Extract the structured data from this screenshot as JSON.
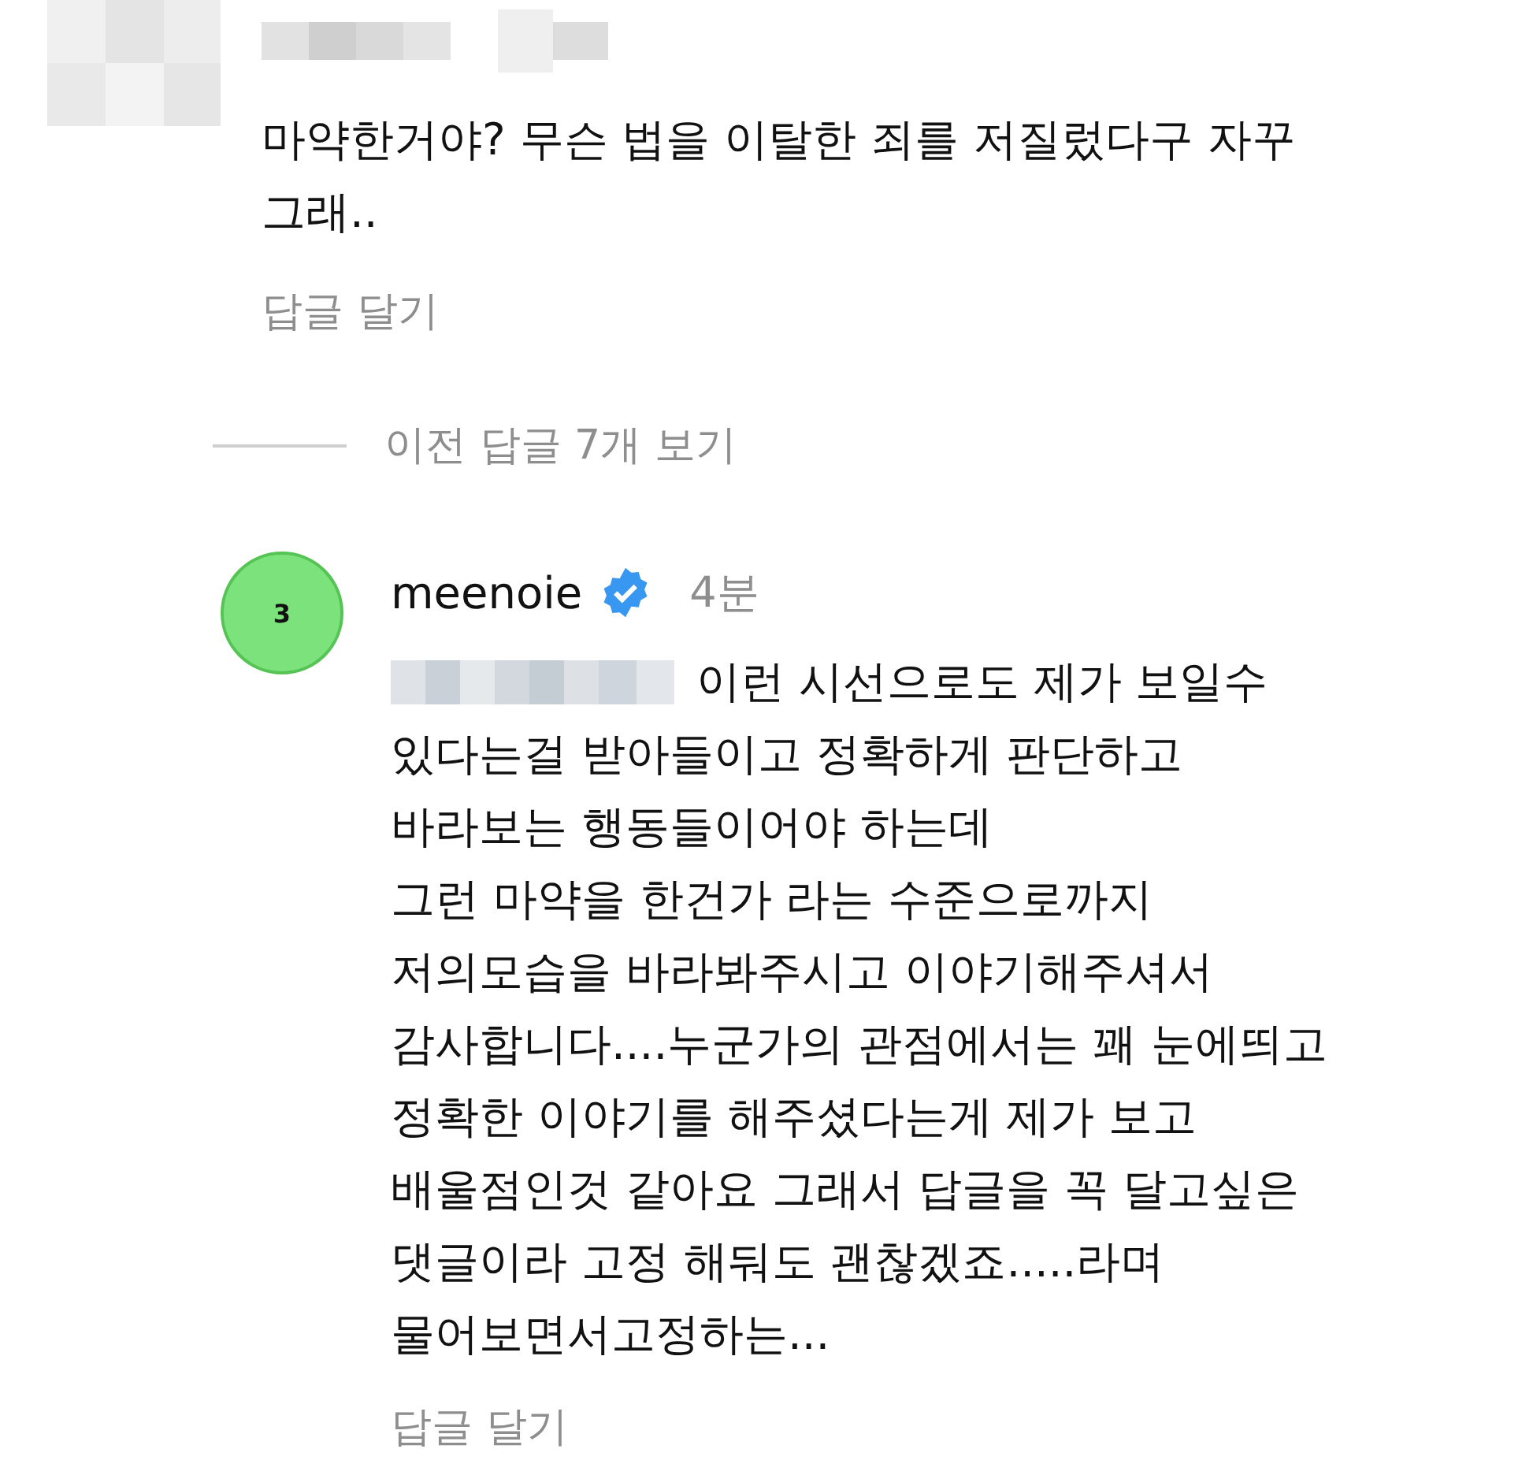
{
  "top_comment": {
    "lines": [
      "마약한거야? 무슨 법을 이탈한 죄를 저질렀다구 자꾸",
      "그래.."
    ],
    "reply_label": "답글 달기"
  },
  "view_replies": "이전 답글 7개 보기",
  "reply": {
    "avatar_text": "3",
    "username": "meenoie",
    "verified": true,
    "time": "4분",
    "first_line": "이런 시선으로도 제가 보일수",
    "lines": [
      "있다는걸 받아들이고 정확하게 판단하고",
      "바라보는 행동들이어야 하는데",
      "그런 마약을 한건가 라는 수준으로까지",
      "저의모습을 바라봐주시고 이야기해주셔서",
      "감사합니다....누군가의 관점에서는 꽤 눈에띄고",
      "정확한 이야기를 해주셨다는게 제가 보고",
      "배울점인것 같아요 그래서 답글을 꼭 달고싶은",
      "댓글이라 고정 해둬도 괜찮겠죠.....라며",
      "물어보면서고정하는..."
    ],
    "reply_label": "답글 달기"
  }
}
